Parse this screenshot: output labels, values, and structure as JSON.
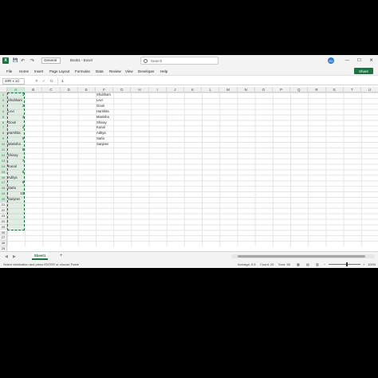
{
  "titlebar": {
    "number_format": "General",
    "doc_title": "Book1 - Excel",
    "search_placeholder": "Search",
    "avatar_initials": "SV",
    "logo_letter": "X",
    "undo_glyph": "↶",
    "redo_glyph": "↷",
    "save_glyph": "💾",
    "minimize_glyph": "—",
    "maximize_glyph": "☐",
    "close_glyph": "✕"
  },
  "ribbon": {
    "tabs": [
      "File",
      "Home",
      "Insert",
      "Page Layout",
      "Formulas",
      "Data",
      "Review",
      "View",
      "Developer",
      "Help"
    ],
    "share_label": "Share"
  },
  "formula_bar": {
    "name_box": "20R x 1C",
    "fx_label": "fx",
    "formula_value": "1"
  },
  "grid": {
    "columns": [
      "A",
      "B",
      "C",
      "D",
      "E",
      "F",
      "G",
      "H",
      "I",
      "J",
      "K",
      "L",
      "M",
      "N",
      "O",
      "P",
      "Q",
      "R",
      "S",
      "T",
      "U"
    ],
    "rows": [
      "1",
      "2",
      "3",
      "4",
      "5",
      "6",
      "7",
      "8",
      "9",
      "10",
      "11",
      "12",
      "13",
      "14",
      "15",
      "16",
      "17",
      "18",
      "19",
      "20",
      "21",
      "22",
      "23",
      "24",
      "25",
      "26",
      "27",
      "28",
      "29",
      "30",
      "31",
      "32",
      "33",
      "34",
      "35",
      "36",
      "37",
      "38"
    ],
    "column_a": [
      "1",
      "Shubham",
      "2",
      "Levi",
      "3",
      "Gouri",
      "4",
      "Harshita",
      "5",
      "Manisha",
      "6",
      "Shivay",
      "7",
      "Kunal",
      "8",
      "Aditya",
      "9",
      "Sarla",
      "10",
      "Sanjeev"
    ],
    "column_f_names": [
      "Shubham",
      "Levi",
      "Gouri",
      "Harshita",
      "Manisha",
      "Shivay",
      "Kunal",
      "Aditya",
      "Sarla",
      "Sanjeev"
    ]
  },
  "sheets": {
    "active": "Sheet1",
    "add_glyph": "+",
    "prev_glyph": "◀",
    "next_glyph": "▶"
  },
  "status": {
    "message": "Select destination and press ENTER or choose Paste",
    "average": "Average: 5.5",
    "count": "Count: 20",
    "sum": "Sum: 55",
    "zoom": "100%",
    "zoom_minus": "−",
    "zoom_plus": "+"
  },
  "colors": {
    "accent": "#1e7145",
    "avatar": "#2e7bcf"
  }
}
